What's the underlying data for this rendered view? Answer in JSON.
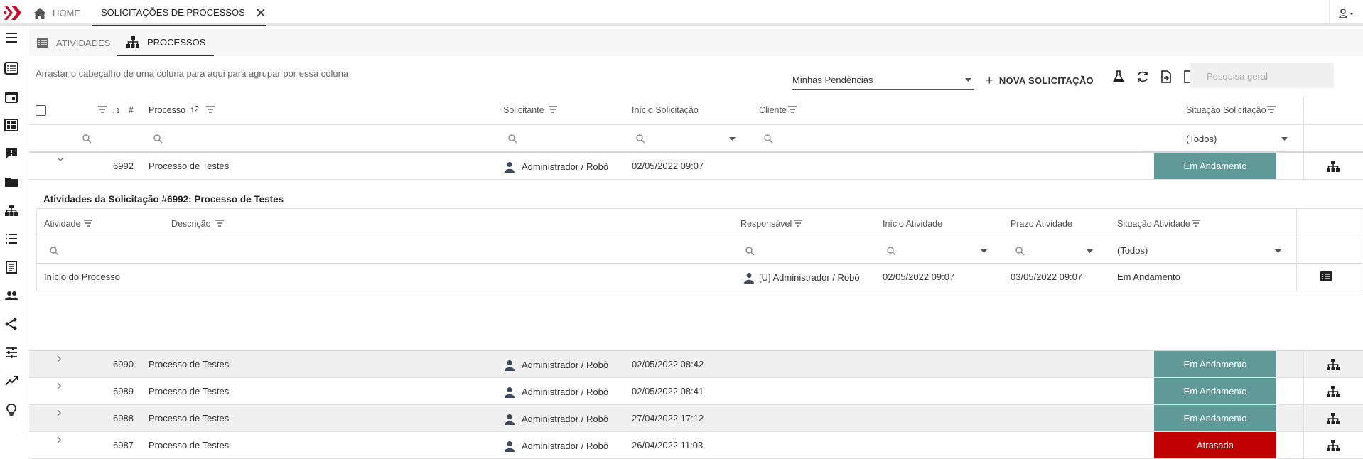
{
  "topbar": {
    "home_label": "HOME",
    "active_tab_label": "SOLICITAÇÕES DE PROCESSOS"
  },
  "subtabs": {
    "atividades": "ATIVIDADES",
    "processos": "PROCESSOS"
  },
  "toolbar": {
    "group_hint": "Arrastar o cabeçalho de uma coluna para aqui para agrupar por essa coluna",
    "filter_selected": "Minhas Pendências",
    "new_button": "NOVA SOLICITAÇÃO",
    "search_placeholder": "Pesquisa geral"
  },
  "grid": {
    "columns": {
      "number": "#",
      "sort_number": "1",
      "processo": "Processo",
      "sort_processo": "2",
      "solicitante": "Solicitante",
      "inicio": "Início Solicitação",
      "cliente": "Cliente",
      "situacao": "Situação Solicitação"
    },
    "situacao_filter": "(Todos)",
    "expanded_row": {
      "id": "6992",
      "processo": "Processo de Testes",
      "solicitante": "Administrador / Robô",
      "inicio": "02/05/2022 09:07",
      "situacao": "Em Andamento"
    },
    "detail": {
      "title": "Atividades da Solicitação #6992: Processo de Testes",
      "columns": {
        "atividade": "Atividade",
        "descricao": "Descrição",
        "responsavel": "Responsável",
        "inicio": "Início Atividade",
        "prazo": "Prazo Atividade",
        "situacao": "Situação Atividade"
      },
      "situacao_filter": "(Todos)",
      "row": {
        "atividade": "Início do Processo",
        "responsavel": "[U] Administrador / Robô",
        "inicio": "02/05/2022 09:07",
        "prazo": "03/05/2022 09:07",
        "situacao": "Em Andamento"
      }
    },
    "rows": [
      {
        "id": "6990",
        "processo": "Processo de Testes",
        "solicitante": "Administrador / Robô",
        "inicio": "02/05/2022 08:42",
        "situacao": "Em Andamento",
        "status_color": "#5f9a99"
      },
      {
        "id": "6989",
        "processo": "Processo de Testes",
        "solicitante": "Administrador / Robô",
        "inicio": "02/05/2022 08:41",
        "situacao": "Em Andamento",
        "status_color": "#5f9a99"
      },
      {
        "id": "6988",
        "processo": "Processo de Testes",
        "solicitante": "Administrador / Robô",
        "inicio": "27/04/2022 17:12",
        "situacao": "Em Andamento",
        "status_color": "#5f9a99"
      },
      {
        "id": "6987",
        "processo": "Processo de Testes",
        "solicitante": "Administrador / Robô",
        "inicio": "26/04/2022 11:03",
        "situacao": "Atrasada",
        "status_color": "#c00000"
      }
    ]
  },
  "colors": {
    "brand": "#c8102e",
    "status_em_andamento": "#5f9a99",
    "status_atrasada": "#c00000"
  },
  "icons": [
    "logo-icon",
    "home-icon",
    "close-icon",
    "user-icon",
    "menu-icon",
    "list-icon",
    "calendar-icon",
    "dashboard-icon",
    "chat-icon",
    "folder-icon",
    "hierarchy-icon",
    "checklist-icon",
    "document-icon",
    "people-icon",
    "share-icon",
    "settings-sliders-icon",
    "trending-icon",
    "lightbulb-icon",
    "flask-icon",
    "refresh-icon",
    "export-icon",
    "columns-icon",
    "filter-icon",
    "search-icon",
    "chevron-down-icon"
  ]
}
